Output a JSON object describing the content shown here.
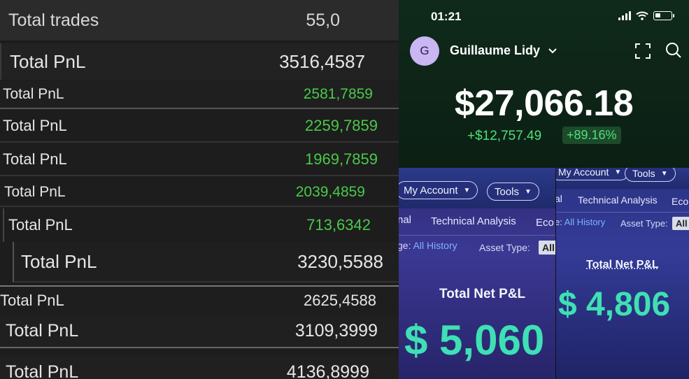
{
  "trades_rows": [
    {
      "label": "Total trades",
      "value": "55,0"
    },
    {
      "label": "Total PnL",
      "value": "3516,4587"
    },
    {
      "label": "Total PnL",
      "value": "2581,7859"
    },
    {
      "label": "Total PnL",
      "value": "2259,7859"
    },
    {
      "label": "Total PnL",
      "value": "1969,7859"
    },
    {
      "label": "Total PnL",
      "value": "2039,4859"
    },
    {
      "label": "Total PnL",
      "value": "713,6342"
    },
    {
      "label": "Total PnL",
      "value": "3230,5588"
    },
    {
      "label": "Total PnL",
      "value": "2625,4588"
    },
    {
      "label": "Total PnL",
      "value": "3109,3999"
    },
    {
      "label": "Total PnL",
      "value": "4136,8999"
    }
  ],
  "phone": {
    "time": "01:21",
    "avatar_initial": "G",
    "user_name": "Guillaume Lidy",
    "balance": "$27,066.18",
    "change": "+$12,757.49",
    "change_pct": "+89.16%"
  },
  "broker_left": {
    "my_account": "My Account",
    "tools": "Tools",
    "tab_partial": "nal",
    "tab_technical": "Technical Analysis",
    "tab_partial2": "Eco",
    "range_label": "ge:",
    "range_value": "All History",
    "asset_label": "Asset Type:",
    "asset_value": "All",
    "net_heading": "Total Net P&L",
    "net_value": "$ 5,060"
  },
  "broker_right": {
    "my_account": "My Account",
    "tools": "Tools",
    "tab_partial": "al",
    "tab_technical": "Technical Analysis",
    "tab_partial2": "Eco",
    "range_label": "e:",
    "range_value": "All History",
    "asset_label": "Asset Type:",
    "asset_value": "All",
    "net_heading": "Total Net P&L",
    "net_value": "$ 4,806"
  }
}
